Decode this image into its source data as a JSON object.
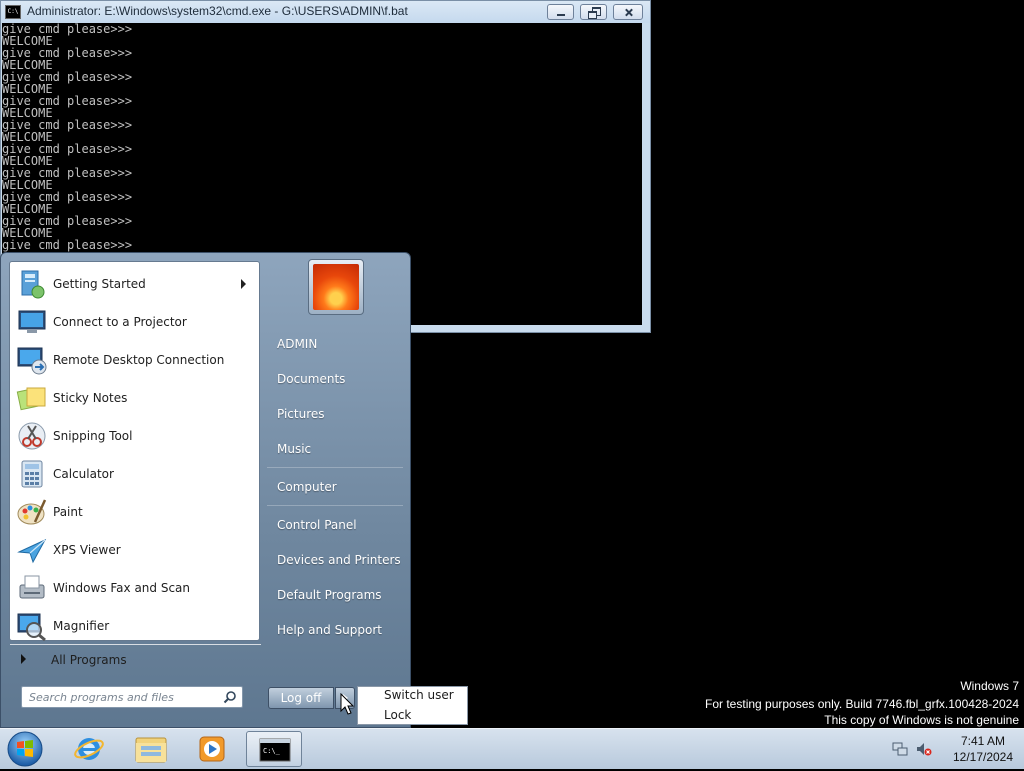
{
  "cmd_window": {
    "title": "Administrator: E:\\Windows\\system32\\cmd.exe - G:\\USERS\\ADMIN\\f.bat",
    "icon": "cmd-icon",
    "console_text": "give cmd please>>>\nWELCOME\ngive cmd please>>>\nWELCOME\ngive cmd please>>>\nWELCOME\ngive cmd please>>>\nWELCOME\ngive cmd please>>>\nWELCOME\ngive cmd please>>>\nWELCOME\ngive cmd please>>>\nWELCOME\ngive cmd please>>>\nWELCOME\ngive cmd please>>>\nWELCOME\ngive cmd please>>>"
  },
  "start_menu": {
    "programs": [
      {
        "label": "Getting Started",
        "icon": "getting-started-icon",
        "has_submenu": true
      },
      {
        "label": "Connect to a Projector",
        "icon": "projector-icon"
      },
      {
        "label": "Remote Desktop Connection",
        "icon": "remote-desktop-icon"
      },
      {
        "label": "Sticky Notes",
        "icon": "sticky-notes-icon"
      },
      {
        "label": "Snipping Tool",
        "icon": "snipping-tool-icon"
      },
      {
        "label": "Calculator",
        "icon": "calculator-icon"
      },
      {
        "label": "Paint",
        "icon": "paint-icon"
      },
      {
        "label": "XPS Viewer",
        "icon": "xps-viewer-icon"
      },
      {
        "label": "Windows Fax and Scan",
        "icon": "fax-scan-icon"
      },
      {
        "label": "Magnifier",
        "icon": "magnifier-icon"
      }
    ],
    "all_programs": "All Programs",
    "search_placeholder": "Search programs and files",
    "right_links": {
      "user": "ADMIN",
      "documents": "Documents",
      "pictures": "Pictures",
      "music": "Music",
      "computer": "Computer",
      "control_panel": "Control Panel",
      "devices": "Devices and Printers",
      "default_programs": "Default Programs",
      "help": "Help and Support"
    },
    "logoff_label": "Log off",
    "power_menu": {
      "switch_user": "Switch user",
      "lock": "Lock"
    }
  },
  "watermark": {
    "line1": "Windows 7",
    "line2": "For testing purposes only. Build 7746.fbl_grfx.100428-2024",
    "line3": "This copy of Windows is not genuine"
  },
  "taskbar": {
    "pinned": [
      "internet-explorer-icon",
      "windows-explorer-icon",
      "media-player-icon",
      "cmd-icon"
    ],
    "tray": [
      "network-icon",
      "volume-muted-icon"
    ],
    "clock_time": "7:41 AM",
    "clock_date": "12/17/2024"
  }
}
